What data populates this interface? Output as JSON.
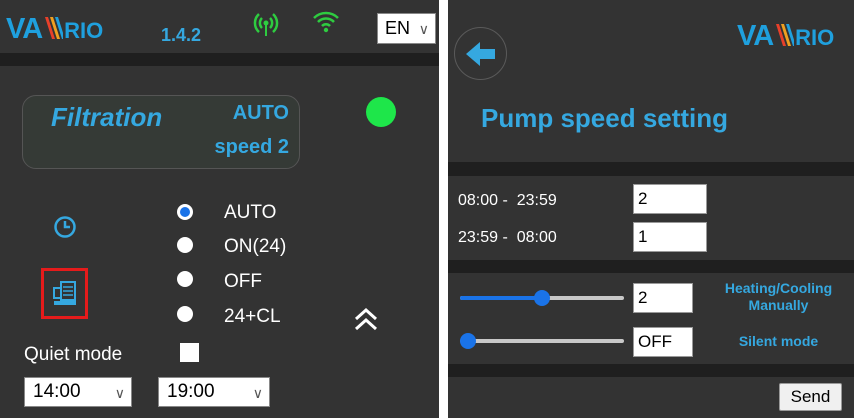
{
  "left": {
    "logo": {
      "part1": "VA",
      "part2": "RIO"
    },
    "version": "1.4.2",
    "language": "EN",
    "status_box": {
      "title": "Filtration",
      "mode": "AUTO",
      "speed": "speed 2",
      "indicator_color": "#1ee64a"
    },
    "modes": [
      {
        "label": "AUTO",
        "selected": true
      },
      {
        "label": "ON(24)",
        "selected": false
      },
      {
        "label": "OFF",
        "selected": false
      },
      {
        "label": "24+CL",
        "selected": false
      }
    ],
    "quiet_mode": {
      "label": "Quiet mode",
      "checked": false
    },
    "time_from": "14:00",
    "time_to": "19:00",
    "icons": [
      "antenna-icon",
      "wifi-icon",
      "clock-icon",
      "pump-icon",
      "double-chevron-up-icon"
    ],
    "highlight_color": "#e51b1b"
  },
  "right": {
    "logo": {
      "part1": "VA",
      "part2": "RIO"
    },
    "title": "Pump speed setting",
    "schedule": [
      {
        "range": "08:00 -  23:59",
        "speed": "2"
      },
      {
        "range": "23:59 -  08:00",
        "speed": "1"
      }
    ],
    "heating_cooling": {
      "label_line1": "Heating/Cooling",
      "label_line2": "Manually",
      "value": "2",
      "slider_fraction": 0.5
    },
    "silent_mode": {
      "label": "Silent mode",
      "value": "OFF",
      "slider_fraction": 0.0
    },
    "send_label": "Send"
  },
  "colors": {
    "panel": "#333333",
    "stripe": "#1f1f1f",
    "accent": "#35a8e0",
    "logo_blue": "#1fa0de",
    "signal_green": "#2ecc40"
  }
}
